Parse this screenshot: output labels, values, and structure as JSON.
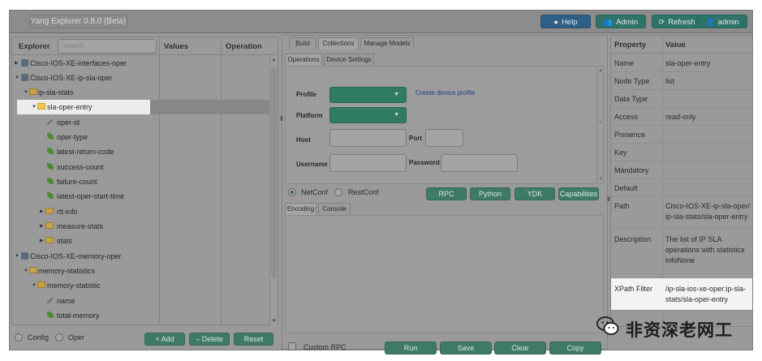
{
  "app": {
    "title": "Yang Explorer 0.8.0 (Beta)",
    "buttons": {
      "help": "Help",
      "admin_group": "Admin",
      "refresh": "Refresh",
      "user": "admin"
    }
  },
  "explorer": {
    "header": "Explorer",
    "search_placeholder": "search",
    "col_values": "Values",
    "col_operation": "Operation",
    "tree": [
      {
        "label": "Cisco-IOS-XE-interfaces-oper",
        "icon": "module-icon",
        "expanded": false
      },
      {
        "label": "Cisco-IOS-XE-ip-sla-oper",
        "icon": "module-icon",
        "expanded": true
      },
      {
        "label": "ip-sla-stats",
        "icon": "folder-icon",
        "expanded": true
      },
      {
        "label": "sla-oper-entry",
        "icon": "list-folder-icon",
        "expanded": true,
        "selected": true
      },
      {
        "label": "oper-id",
        "icon": "key-icon"
      },
      {
        "label": "oper-type",
        "icon": "leaf-icon"
      },
      {
        "label": "latest-return-code",
        "icon": "leaf-icon"
      },
      {
        "label": "success-count",
        "icon": "leaf-icon"
      },
      {
        "label": "failure-count",
        "icon": "leaf-icon"
      },
      {
        "label": "latest-oper-start-time",
        "icon": "leaf-icon"
      },
      {
        "label": "rtt-info",
        "icon": "folder-icon",
        "expanded": false
      },
      {
        "label": "measure-stats",
        "icon": "folder-icon",
        "expanded": false
      },
      {
        "label": "stats",
        "icon": "folder-icon",
        "expanded": false
      },
      {
        "label": "Cisco-IOS-XE-memory-oper",
        "icon": "module-icon",
        "expanded": true
      },
      {
        "label": "memory-statistics",
        "icon": "folder-icon",
        "expanded": true
      },
      {
        "label": "memory-statistic",
        "icon": "list-folder-icon",
        "expanded": true
      },
      {
        "label": "name",
        "icon": "key-icon"
      },
      {
        "label": "total-memory",
        "icon": "leaf-icon"
      }
    ],
    "footer": {
      "config": "Config",
      "oper": "Oper",
      "add": "+ Add",
      "delete": "– Delete",
      "reset": "Reset"
    }
  },
  "middle": {
    "top_tabs": [
      "Build",
      "Collections",
      "Manage Models"
    ],
    "sub_tabs": [
      "Operations",
      "Device Settings"
    ],
    "form": {
      "profile_label": "Profile",
      "platform_label": "Platform",
      "host_label": "Host",
      "port_label": "Port",
      "username_label": "Username",
      "password_label": "Password",
      "create_profile_link": "Create device profile"
    },
    "protocol": {
      "netconf": "NetConf",
      "restconf": "RestConf"
    },
    "action_buttons": [
      "RPC",
      "Python",
      "YDK",
      "Capabilities"
    ],
    "lower_tabs": [
      "Encoding",
      "Console"
    ],
    "footer": {
      "custom_rpc": "Custom RPC",
      "run": "Run",
      "save": "Save",
      "clear": "Clear",
      "copy": "Copy"
    }
  },
  "properties": {
    "col_property": "Property",
    "col_value": "Value",
    "rows": [
      {
        "k": "Name",
        "v": "sla-oper-entry"
      },
      {
        "k": "Node Type",
        "v": "list"
      },
      {
        "k": "Data Type",
        "v": ""
      },
      {
        "k": "Access",
        "v": "read-only"
      },
      {
        "k": "Presence",
        "v": ""
      },
      {
        "k": "Key",
        "v": ""
      },
      {
        "k": "Mandatory",
        "v": ""
      },
      {
        "k": "Default",
        "v": ""
      },
      {
        "k": "Path",
        "v": "Cisco-IOS-XE-ip-sla-oper/ ip-sla-stats/sla-oper-entry"
      },
      {
        "k": "Description",
        "v": "The list of IP SLA operations with statistics infoNone"
      },
      {
        "k": "XPath Filter",
        "v": "/ip-sla-ios-xe-oper:ip-sla-stats/sla-oper-entry"
      }
    ]
  },
  "watermark": {
    "text": "非资深老网工"
  }
}
